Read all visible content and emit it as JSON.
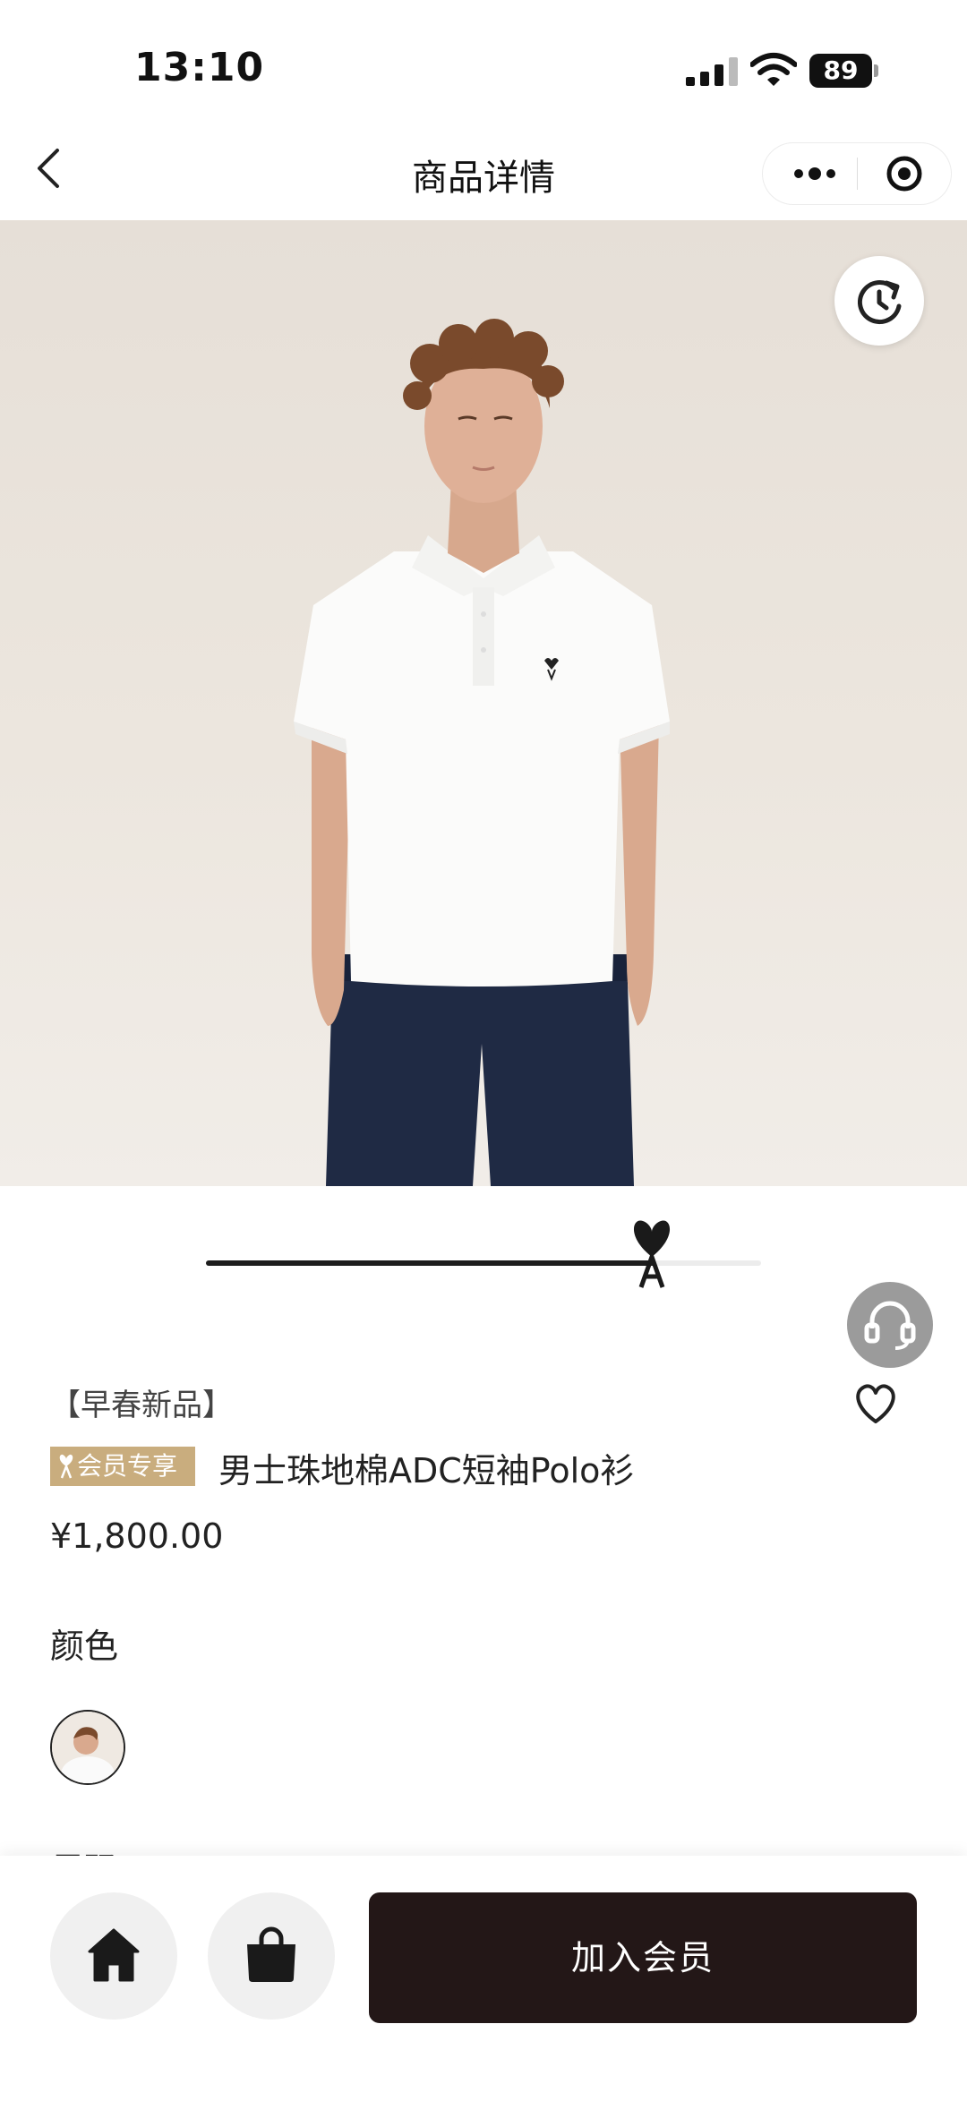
{
  "status_bar": {
    "time": "13:10",
    "battery": "89"
  },
  "nav": {
    "title": "商品详情"
  },
  "product": {
    "season_tag": "【早春新品】",
    "member_badge": "会员专享",
    "name": "男士珠地棉ADC短袖Polo衫",
    "price": "¥1,800.00",
    "color_label": "颜色",
    "size_label_peek": "尺码"
  },
  "gallery": {
    "progress": 0.81
  },
  "bottom_bar": {
    "join_label": "加入会员"
  },
  "colors": {
    "badge_gold": "#c9ad7e",
    "primary_dark": "#231717",
    "service_gray": "#9b9b9b"
  }
}
